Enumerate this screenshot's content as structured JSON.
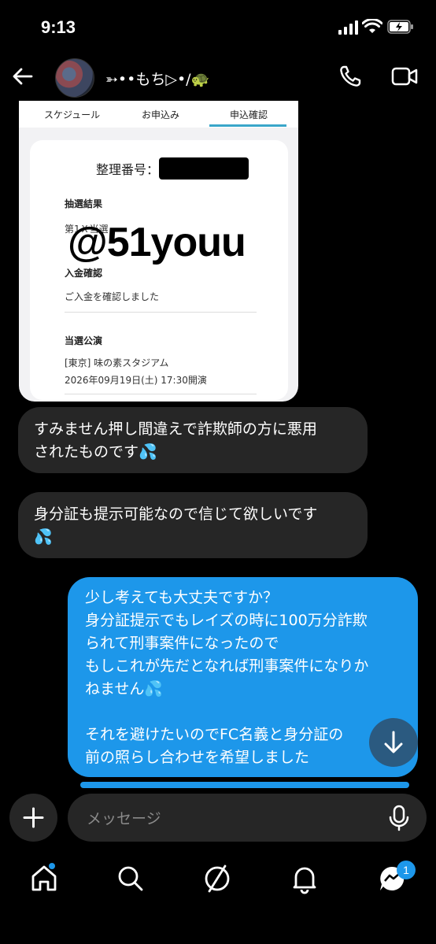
{
  "status_bar": {
    "time": "9:13"
  },
  "header": {
    "name": "➳••もち▷•/🐢",
    "icons": [
      "back-arrow-icon",
      "phone-icon",
      "video-camera-icon"
    ]
  },
  "shared_image": {
    "tabs": [
      "スケジュール",
      "お申込み",
      "申込確認"
    ],
    "active_tab": "申込確認",
    "ticket_number_label": "整理番号：",
    "lottery_result_title": "抽選結果",
    "lottery_result_text": "第1Ｘ当選",
    "payment_title": "入金確認",
    "payment_text": "ご入金を確認しました",
    "performance_title": "当選公演",
    "venue": "[東京] 味の素スタジアム",
    "datetime": "2026年09月19日(土) 17:30開演",
    "watermark": "@51youu"
  },
  "messages": [
    {
      "direction": "incoming",
      "text": "すみません押し間違えで詐欺師の方に悪用\nされたものです💦"
    },
    {
      "direction": "incoming",
      "text": "身分証も提示可能なので信じて欲しいです\n💦"
    },
    {
      "direction": "outgoing",
      "text": "少し考えても大丈夫ですか？\n身分証提示でもレイズの時に100万分詐欺\nられて刑事案件になったので\nもしこれが先だとなれば刑事案件になりか\nねません💦\n\nそれを避けたいのでFC名義と身分証の\n前の照らし合わせを希望しました"
    }
  ],
  "composer": {
    "placeholder": "メッセージ"
  },
  "nav": {
    "items": [
      "home-icon",
      "search-icon",
      "explore-icon",
      "notifications-icon",
      "messages-icon"
    ],
    "messages_badge": "1"
  },
  "colors": {
    "background": "#000000",
    "incoming_bubble": "#262626",
    "outgoing_bubble": "#1d97ea",
    "accent": "#1d97ea"
  }
}
